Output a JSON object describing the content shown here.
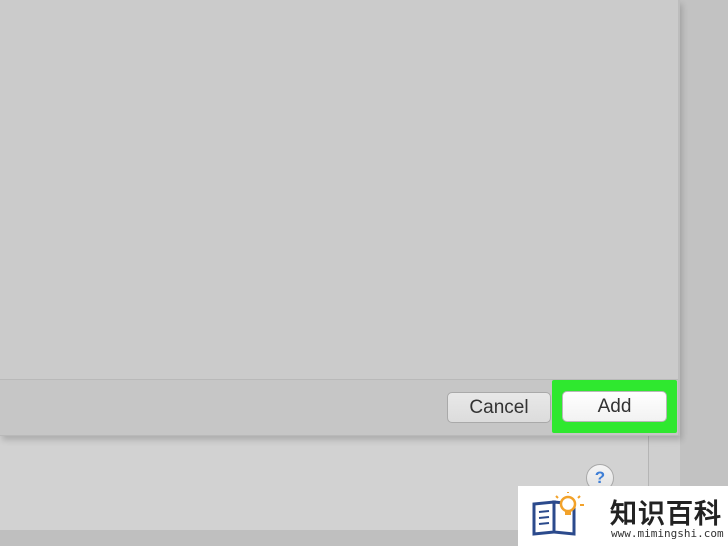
{
  "dialog": {
    "cancel_label": "Cancel",
    "add_label": "Add",
    "highlight_color": "#2fe82f"
  },
  "window": {
    "help_label": "?"
  },
  "watermark": {
    "title": "知识百科",
    "url": "www.mimingshi.com"
  }
}
